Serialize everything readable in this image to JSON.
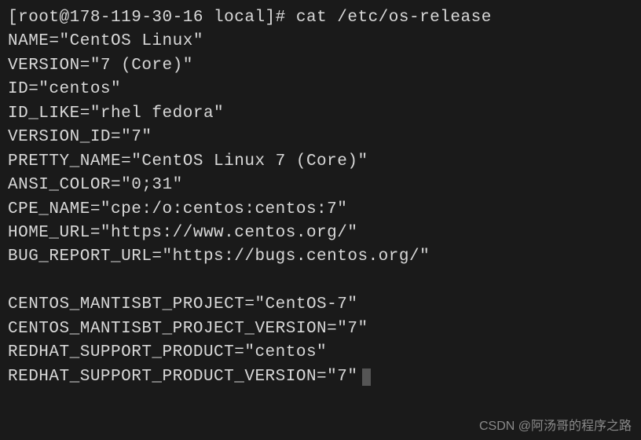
{
  "terminal": {
    "prompt": "[root@178-119-30-16 local]# ",
    "command": "cat /etc/os-release",
    "output": [
      "NAME=\"CentOS Linux\"",
      "VERSION=\"7 (Core)\"",
      "ID=\"centos\"",
      "ID_LIKE=\"rhel fedora\"",
      "VERSION_ID=\"7\"",
      "PRETTY_NAME=\"CentOS Linux 7 (Core)\"",
      "ANSI_COLOR=\"0;31\"",
      "CPE_NAME=\"cpe:/o:centos:centos:7\"",
      "HOME_URL=\"https://www.centos.org/\"",
      "BUG_REPORT_URL=\"https://bugs.centos.org/\"",
      "",
      "CENTOS_MANTISBT_PROJECT=\"CentOS-7\"",
      "CENTOS_MANTISBT_PROJECT_VERSION=\"7\"",
      "REDHAT_SUPPORT_PRODUCT=\"centos\"",
      "REDHAT_SUPPORT_PRODUCT_VERSION=\"7\""
    ]
  },
  "watermark": "CSDN @阿汤哥的程序之路"
}
